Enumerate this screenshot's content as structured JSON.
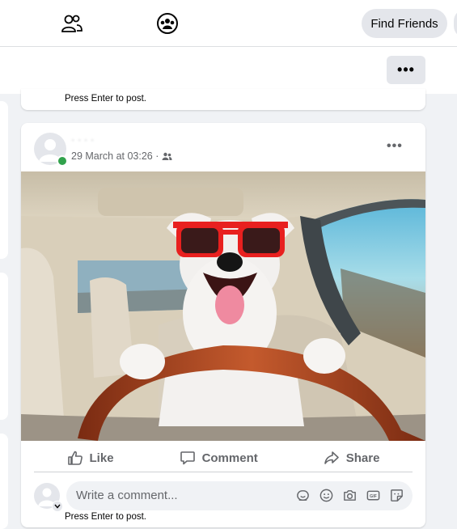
{
  "nav": {
    "friends_icon": "friends-icon",
    "groups_icon": "groups-icon",
    "find_friends_label": "Find Friends"
  },
  "header": {
    "more_label": "•••"
  },
  "previous_post": {
    "hint": "Press Enter to post."
  },
  "post": {
    "author": "· ·  · ·",
    "timestamp": "29 March at 03:26 ·",
    "audience_icon": "friends-audience-icon",
    "more_label": "•••",
    "image_alt": "dog wearing red sunglasses driving a car",
    "actions": {
      "like": "Like",
      "comment": "Comment",
      "share": "Share"
    },
    "comment_box": {
      "placeholder": "Write a comment...",
      "hint": "Press Enter to post.",
      "icons": [
        "sticker-face-icon",
        "emoji-icon",
        "camera-icon",
        "gif-icon",
        "sticker-icon"
      ]
    }
  },
  "colors": {
    "accent_online": "#31a24c",
    "sunglasses": "#e8201f",
    "button_gray": "#e4e6eb"
  }
}
